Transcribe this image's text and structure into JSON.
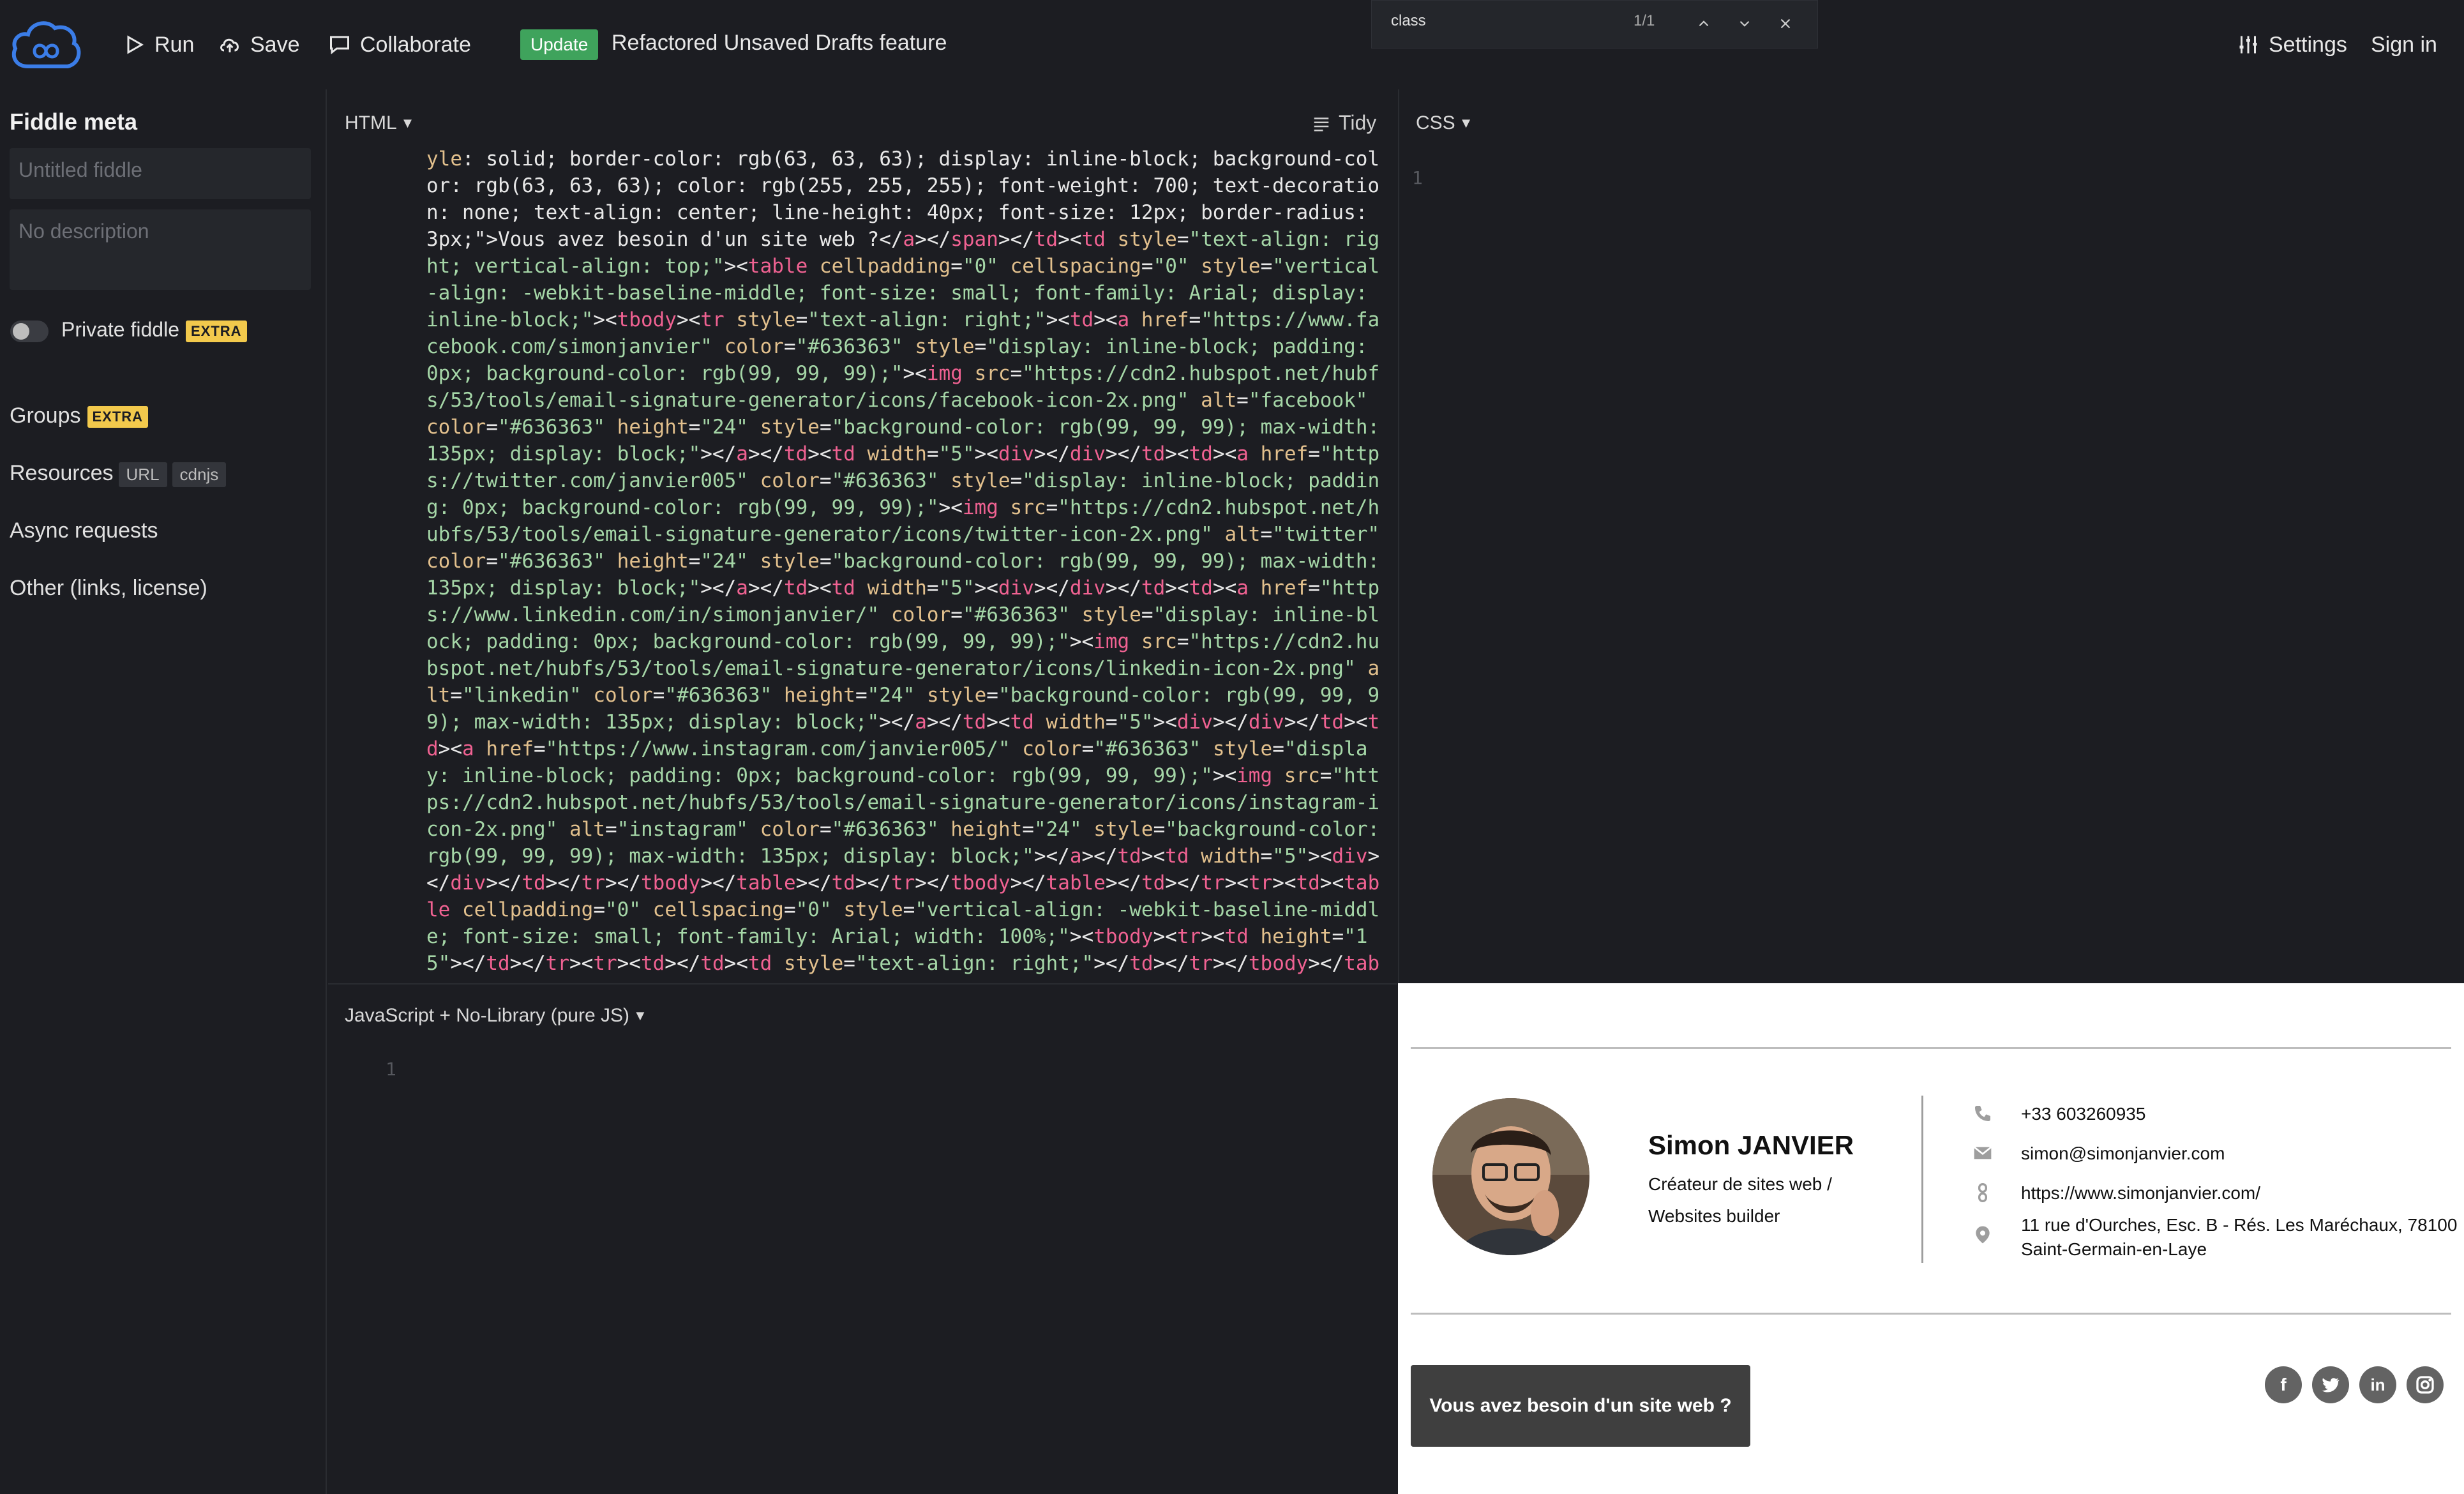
{
  "header": {
    "run_label": "Run",
    "save_label": "Save",
    "collaborate_label": "Collaborate",
    "update_badge": "Update",
    "update_text": "Refactored Unsaved Drafts feature",
    "settings_label": "Settings",
    "signin_label": "Sign in"
  },
  "search": {
    "query": "class",
    "count": "1/1"
  },
  "sidebar": {
    "title": "Fiddle meta",
    "name_placeholder": "Untitled fiddle",
    "description_placeholder": "No description",
    "private_label": "Private fiddle",
    "extra_badge": "EXTRA",
    "groups_label": "Groups",
    "resources_label": "Resources",
    "resources_tags": [
      "URL",
      "cdnjs"
    ],
    "async_label": "Async requests",
    "other_label": "Other (links, license)"
  },
  "editors": {
    "html_label": "HTML",
    "tidy_label": "Tidy",
    "css_label": "CSS",
    "css_line": "1",
    "js_label": "JavaScript + No-Library (pure JS)",
    "js_line": "1"
  },
  "signature": {
    "name": "Simon JANVIER",
    "role_line1": "Créateur de sites web /",
    "role_line2": "Websites builder",
    "phone": "+33 603260935",
    "email": "simon@simonjanvier.com",
    "website": "https://www.simonjanvier.com/",
    "address_line1": "11 rue d'Ourches, Esc. B - Rés. Les Maréchaux, 78100",
    "address_line2": "Saint-Germain-en-Laye",
    "cta": "Vous avez besoin d'un site web ?"
  },
  "icons": {
    "logo": "jsfiddle-cloud-logo",
    "run": "play-icon",
    "save": "cloud-upload-icon",
    "collaborate": "chat-icon",
    "settings": "sliders-icon"
  },
  "colors": {
    "background": "#1c1d22",
    "update_badge": "#3fa35c",
    "extra_badge": "#f2c94c",
    "code_tag": "#f06292",
    "code_attr": "#e2c08d",
    "code_string": "#a5d6a7",
    "signature_icon_bg": "#636363"
  }
}
